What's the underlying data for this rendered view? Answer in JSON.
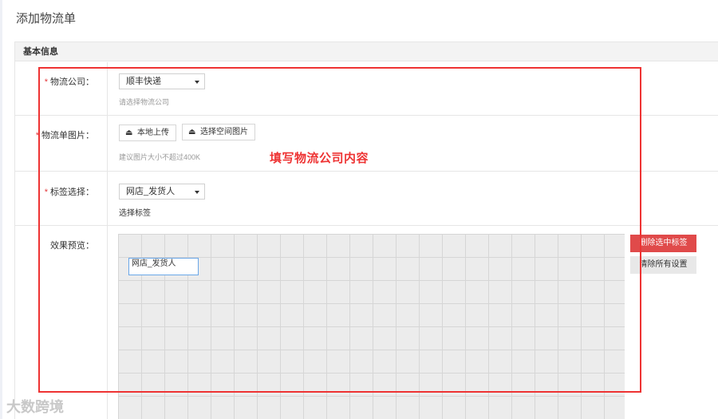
{
  "page": {
    "title": "添加物流单"
  },
  "panel": {
    "header": "基本信息"
  },
  "logistics_company": {
    "required_mark": "*",
    "label": "物流公司：",
    "selected": "顺丰快递",
    "hint": "请选择物流公司"
  },
  "waybill_image": {
    "required_mark": "*",
    "label": "物流单图片：",
    "local_upload_label": "本地上传",
    "space_select_label": "选择空间图片",
    "hint": "建议图片大小不超过400K"
  },
  "tag_select": {
    "required_mark": "*",
    "label": "标签选择：",
    "selected": "网店_发货人",
    "hint": "选择标签"
  },
  "preview": {
    "label": "效果预览：",
    "tag_text": "网店_发货人",
    "delete_selected_label": "删除选中标签",
    "clear_all_label": "清除所有设置"
  },
  "annotation": {
    "text": "填写物流公司内容",
    "color": "#e33333"
  },
  "watermark": {
    "text": "大数跨境"
  },
  "colors": {
    "accent_red": "#e04a4a",
    "required_star": "#e4393c",
    "selected_tag_border": "#6aa7e8"
  },
  "icons": {
    "upload": "upload-icon",
    "caret": "caret-down-icon"
  }
}
